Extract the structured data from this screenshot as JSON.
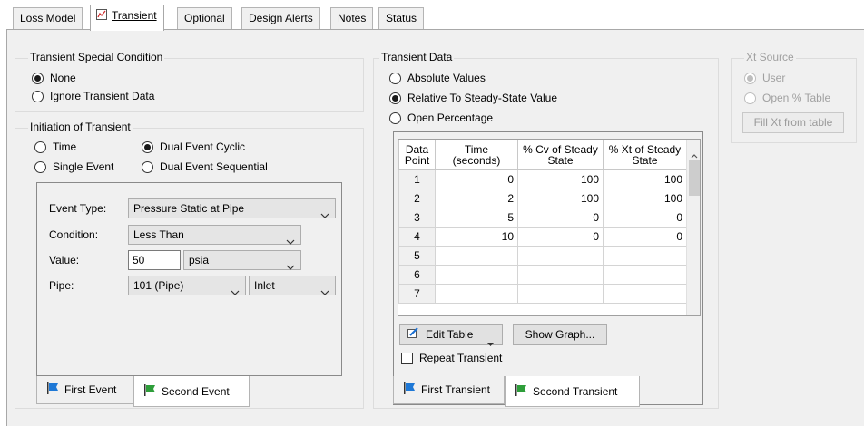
{
  "tabs": [
    {
      "label": "Loss Model"
    },
    {
      "label": "Transient",
      "active": true
    },
    {
      "label": "Optional"
    },
    {
      "label": "Design Alerts"
    },
    {
      "label": "Notes"
    },
    {
      "label": "Status"
    }
  ],
  "special_condition": {
    "title": "Transient Special Condition",
    "options": [
      {
        "label": "None",
        "selected": true
      },
      {
        "label": "Ignore Transient Data",
        "selected": false
      }
    ]
  },
  "initiation": {
    "title": "Initiation of Transient",
    "options": [
      {
        "label": "Time",
        "selected": false
      },
      {
        "label": "Dual Event Cyclic",
        "selected": true
      },
      {
        "label": "Single Event",
        "selected": false
      },
      {
        "label": "Dual Event Sequential",
        "selected": false
      }
    ],
    "event_type_label": "Event Type:",
    "event_type_value": "Pressure Static at Pipe",
    "condition_label": "Condition:",
    "condition_value": "Less Than",
    "value_label": "Value:",
    "value_input": "50",
    "value_unit": "psia",
    "pipe_label": "Pipe:",
    "pipe_value": "101 (Pipe)",
    "pipe_end": "Inlet",
    "subtabs": [
      {
        "label": "First Event",
        "active": false
      },
      {
        "label": "Second Event",
        "active": true
      }
    ]
  },
  "transient_data": {
    "title": "Transient Data",
    "options": [
      {
        "label": "Absolute Values",
        "selected": false
      },
      {
        "label": "Relative To Steady-State Value",
        "selected": true
      },
      {
        "label": "Open Percentage",
        "selected": false
      }
    ],
    "columns": [
      "Data Point",
      "Time (seconds)",
      "% Cv of Steady State",
      "% Xt of Steady State"
    ],
    "rows": [
      {
        "point": "1",
        "time": "0",
        "cv": "100",
        "xt": "100"
      },
      {
        "point": "2",
        "time": "2",
        "cv": "100",
        "xt": "100"
      },
      {
        "point": "3",
        "time": "5",
        "cv": "0",
        "xt": "0"
      },
      {
        "point": "4",
        "time": "10",
        "cv": "0",
        "xt": "0"
      },
      {
        "point": "5",
        "time": "",
        "cv": "",
        "xt": ""
      },
      {
        "point": "6",
        "time": "",
        "cv": "",
        "xt": ""
      },
      {
        "point": "7",
        "time": "",
        "cv": "",
        "xt": ""
      }
    ],
    "edit_table_label": "Edit Table",
    "show_graph_label": "Show Graph...",
    "repeat_label": "Repeat Transient",
    "repeat_checked": false,
    "subtabs": [
      {
        "label": "First Transient",
        "active": false
      },
      {
        "label": "Second Transient",
        "active": true
      }
    ]
  },
  "xt_source": {
    "title": "Xt Source",
    "options": [
      {
        "label": "User",
        "selected": true
      },
      {
        "label": "Open % Table",
        "selected": false
      }
    ],
    "fill_button": "Fill Xt from table"
  },
  "colors": {
    "accent": "#1a6fd1",
    "flag_blue": "#1e78d6",
    "flag_green": "#2e9e3a",
    "panel": "#f0f0f0"
  },
  "icons": [
    "transient-graph-icon",
    "edit-table-icon",
    "blue-flag-icon",
    "green-flag-icon",
    "chevron-down-icon"
  ]
}
